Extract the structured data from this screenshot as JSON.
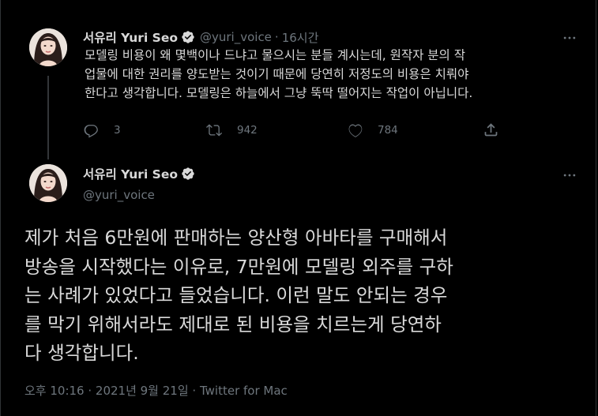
{
  "colors": {
    "background": "#000000",
    "text_primary": "#d9d9d9",
    "text_secondary": "#6e767d",
    "verified_badge": "#d9d9d9"
  },
  "reply_tweet": {
    "display_name": "서유리 Yuri Seo",
    "handle": "@yuri_voice",
    "separator": "·",
    "time": "16시간",
    "text": "모델링 비용이 왜 몇백이나 드냐고 물으시는 분들 계시는데, 원작자 분의 작\n업물에 대한 권리를 양도받는 것이기 때문에 당연히 저정도의 비용은 치뤄야\n한다고 생각합니다. 모델링은 하늘에서 그냥 뚝딱 떨어지는 작업이 아닙니다.",
    "actions": {
      "reply_count": "3",
      "retweet_count": "942",
      "like_count": "784"
    },
    "icons": [
      "comment-icon",
      "retweet-icon",
      "heart-icon",
      "share-icon",
      "more-icon",
      "verified-icon"
    ]
  },
  "main_tweet": {
    "display_name": "서유리 Yuri Seo",
    "handle": "@yuri_voice",
    "text": "제가 처음 6만원에 판매하는 양산형 아바타를 구매해서\n방송을 시작했다는 이유로, 7만원에 모델링 외주를 구하\n는 사례가 있었다고 들었습니다. 이런 말도 안되는 경우\n를 막기 위해서라도 제대로 된 비용을 치르는게 당연하\n다 생각합니다.",
    "timestamp": "오후 10:16 · 2021년 9월 21일",
    "meta_separator": "·",
    "source": "Twitter for Mac"
  }
}
